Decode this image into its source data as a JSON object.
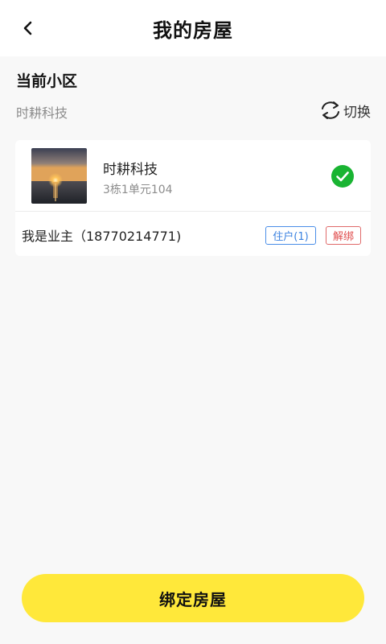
{
  "header": {
    "title": "我的房屋",
    "back_icon": "chevron-left-icon"
  },
  "current_community": {
    "section_title": "当前小区",
    "name": "时耕科技",
    "switch_label": "切换",
    "switch_icon": "refresh-icon"
  },
  "house": {
    "name": "时耕科技",
    "unit": "3栋1单元104",
    "selected": true,
    "check_color": "#19b432",
    "owner_text": "我是业主（18770214771)",
    "resident_label": "住户(1)",
    "unbind_label": "解绑"
  },
  "footer": {
    "bind_label": "绑定房屋",
    "bind_color": "#ffe83a"
  }
}
